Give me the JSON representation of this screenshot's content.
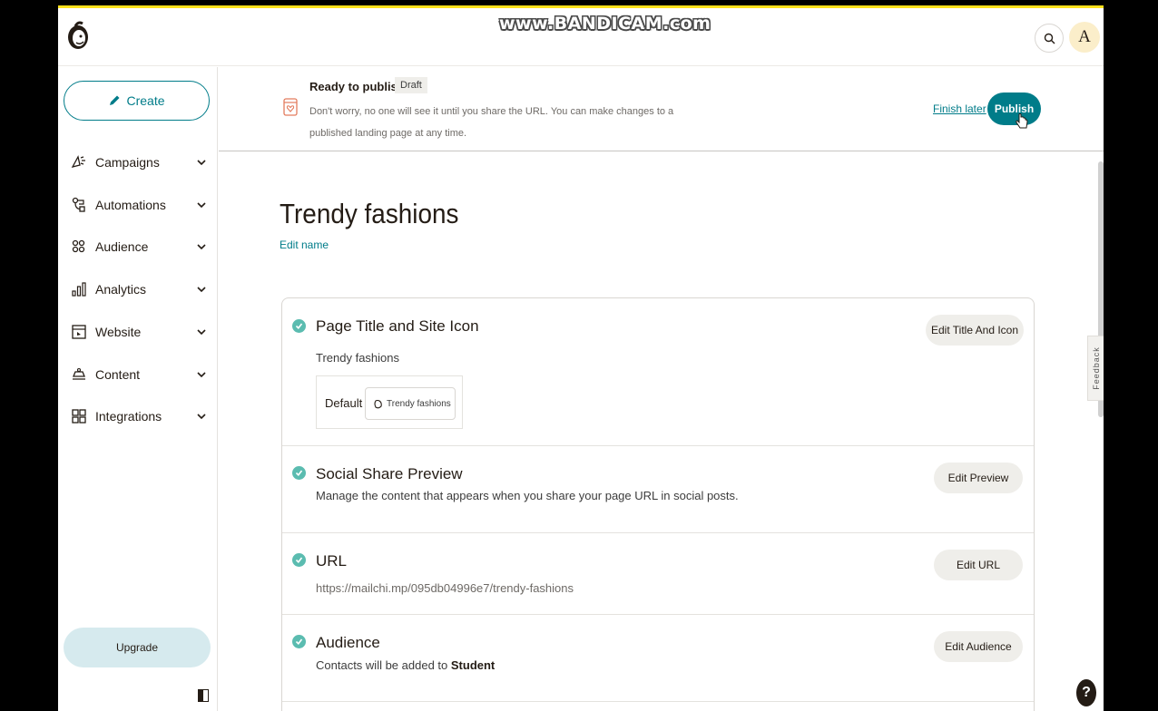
{
  "watermark": "www.BANDICAM.com",
  "header": {
    "avatar_initial": "A",
    "search_icon": "search-icon",
    "logo_icon": "mailchimp-logo"
  },
  "sidebar": {
    "create_label": "Create",
    "items": [
      {
        "label": "Campaigns",
        "icon": "megaphone-icon"
      },
      {
        "label": "Automations",
        "icon": "automations-icon"
      },
      {
        "label": "Audience",
        "icon": "audience-icon"
      },
      {
        "label": "Analytics",
        "icon": "analytics-icon"
      },
      {
        "label": "Website",
        "icon": "website-icon"
      },
      {
        "label": "Content",
        "icon": "content-icon"
      },
      {
        "label": "Integrations",
        "icon": "integrations-icon"
      }
    ],
    "upgrade_label": "Upgrade"
  },
  "banner": {
    "title": "Ready to publish!",
    "badge": "Draft",
    "description": "Don't worry, no one will see it until you share the URL. You can make changes to a published landing page at any time.",
    "finish_later": "Finish later",
    "publish": "Publish"
  },
  "page": {
    "title": "Trendy fashions",
    "edit_name": "Edit name"
  },
  "sections": {
    "title_icon": {
      "title": "Page Title and Site Icon",
      "value": "Trendy fashions",
      "default_label": "Default",
      "tab_text": "Trendy fashions",
      "button": "Edit Title And Icon"
    },
    "social": {
      "title": "Social Share Preview",
      "subtitle": "Manage the content that appears when you share your page URL in social posts.",
      "button": "Edit Preview"
    },
    "url": {
      "title": "URL",
      "value": "https://mailchi.mp/095db04996e7/trendy-fashions",
      "button": "Edit URL"
    },
    "audience": {
      "title": "Audience",
      "subtitle_prefix": "Contacts will be added to ",
      "subtitle_bold": "Student",
      "button": "Edit Audience"
    }
  },
  "feedback": "Feedback",
  "help": "?",
  "colors": {
    "accent": "#007c89",
    "check": "#5bbcb0",
    "brand_yellow": "#ffe01b"
  }
}
